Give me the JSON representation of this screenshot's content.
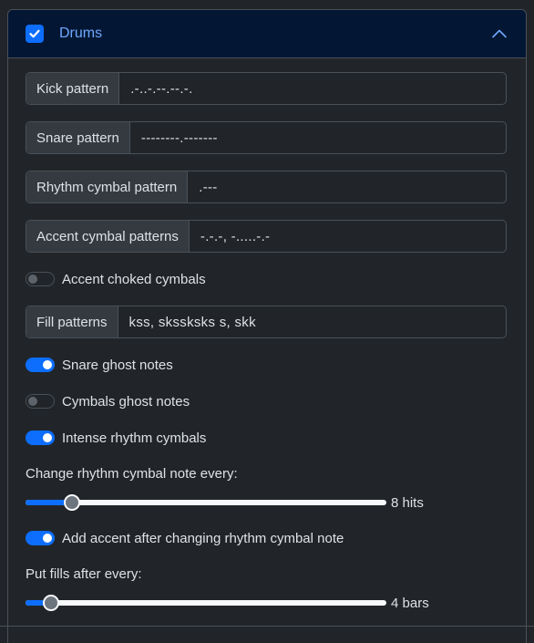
{
  "header": {
    "title": "Drums",
    "checked": true
  },
  "inputs": [
    {
      "label": "Kick pattern",
      "value": ".-..-.--.--.-."
    },
    {
      "label": "Snare pattern",
      "value": "--------.-------"
    },
    {
      "label": "Rhythm cymbal pattern",
      "value": ".---"
    },
    {
      "label": "Accent cymbal patterns",
      "value": "-.-.-, -.....-.-"
    }
  ],
  "toggles": {
    "accent_choked": {
      "label": "Accent choked cymbals",
      "on": false
    },
    "snare_ghost": {
      "label": "Snare ghost notes",
      "on": true
    },
    "cymbals_ghost": {
      "label": "Cymbals ghost notes",
      "on": false
    },
    "intense_rhythm": {
      "label": "Intense rhythm cymbals",
      "on": true
    },
    "add_accent": {
      "label": "Add accent after changing rhythm cymbal note",
      "on": true
    }
  },
  "fill": {
    "label": "Fill patterns",
    "value": "kss, skssksks s, skk"
  },
  "sliders": {
    "rhythm_change": {
      "label": "Change rhythm cymbal note every:",
      "value_text": "8 hits",
      "level": 0.13
    },
    "fills_every": {
      "label": "Put fills after every:",
      "value_text": "4 bars",
      "level": 0.07
    }
  },
  "colors": {
    "accent": "#0d6efd",
    "header_bg": "#031633",
    "header_text": "#6ea8fe"
  },
  "icons": {
    "checkbox": "check-icon",
    "collapse": "chevron-up-icon"
  }
}
